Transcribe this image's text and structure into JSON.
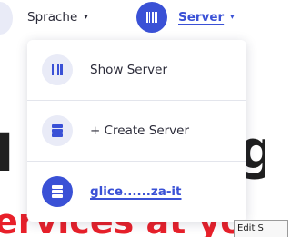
{
  "nav": {
    "sprache_label": "Sprache",
    "server_label": "Server",
    "caret_glyph": "▾"
  },
  "dropdown": {
    "items": [
      {
        "label": "Show Server",
        "icon": "barcode-server-icon"
      },
      {
        "label": "+ Create Server",
        "icon": "server-stack-icon"
      },
      {
        "label": "glice......za-it",
        "icon": "server-stack-icon",
        "active": true
      }
    ]
  },
  "background": {
    "heading_left": "I",
    "heading_right": "g",
    "subheading": "ervices at yo"
  },
  "tooltip": {
    "text": "Edit S"
  },
  "colors": {
    "accent": "#3a51d6",
    "icon_bg_light": "#e9ebf7",
    "text": "#2c2c3a",
    "red": "#e8202a"
  }
}
